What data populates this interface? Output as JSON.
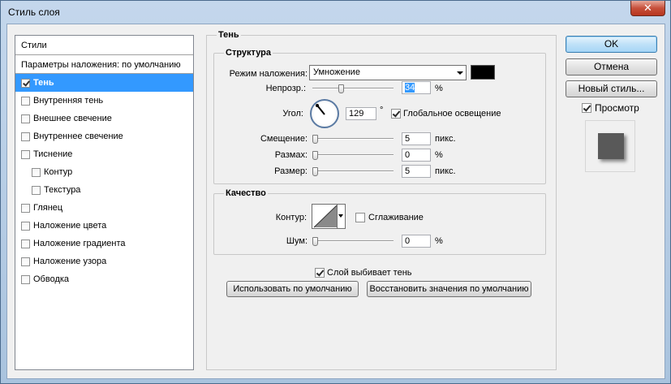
{
  "window": {
    "title": "Стиль слоя",
    "close_label": "✕"
  },
  "styles": {
    "header": "Стили",
    "default_label": "Параметры наложения: по умолчанию",
    "items": [
      {
        "label": "Тень",
        "checked": true,
        "selected": true,
        "indent": false
      },
      {
        "label": "Внутренняя тень",
        "checked": false,
        "selected": false,
        "indent": false
      },
      {
        "label": "Внешнее свечение",
        "checked": false,
        "selected": false,
        "indent": false
      },
      {
        "label": "Внутреннее свечение",
        "checked": false,
        "selected": false,
        "indent": false
      },
      {
        "label": "Тиснение",
        "checked": false,
        "selected": false,
        "indent": false
      },
      {
        "label": "Контур",
        "checked": false,
        "selected": false,
        "indent": true
      },
      {
        "label": "Текстура",
        "checked": false,
        "selected": false,
        "indent": true
      },
      {
        "label": "Глянец",
        "checked": false,
        "selected": false,
        "indent": false
      },
      {
        "label": "Наложение цвета",
        "checked": false,
        "selected": false,
        "indent": false
      },
      {
        "label": "Наложение градиента",
        "checked": false,
        "selected": false,
        "indent": false
      },
      {
        "label": "Наложение узора",
        "checked": false,
        "selected": false,
        "indent": false
      },
      {
        "label": "Обводка",
        "checked": false,
        "selected": false,
        "indent": false
      }
    ]
  },
  "shadow": {
    "title": "Тень",
    "structure": {
      "title": "Структура",
      "blend_mode_label": "Режим наложения:",
      "blend_mode_value": "Умножение",
      "color": "#000000",
      "opacity_label": "Непрозр.:",
      "opacity_value": "34",
      "opacity_unit": "%",
      "opacity_level": 34,
      "angle_label": "Угол:",
      "angle_value": "129",
      "angle_unit": "°",
      "global_light_label": "Глобальное освещение",
      "global_light_checked": true,
      "distance_label": "Смещение:",
      "distance_value": "5",
      "distance_unit": "пикс.",
      "spread_label": "Размах:",
      "spread_value": "0",
      "spread_unit": "%",
      "size_label": "Размер:",
      "size_value": "5",
      "size_unit": "пикс."
    },
    "quality": {
      "title": "Качество",
      "contour_label": "Контур:",
      "antialias_label": "Сглаживание",
      "antialias_checked": false,
      "noise_label": "Шум:",
      "noise_value": "0",
      "noise_unit": "%"
    },
    "knockout_label": "Слой выбивает тень",
    "knockout_checked": true,
    "make_default_label": "Использовать по умолчанию",
    "reset_default_label": "Восстановить значения по умолчанию"
  },
  "buttons": {
    "ok": "OK",
    "cancel": "Отмена",
    "new_style": "Новый стиль...",
    "preview_label": "Просмотр",
    "preview_checked": true
  }
}
